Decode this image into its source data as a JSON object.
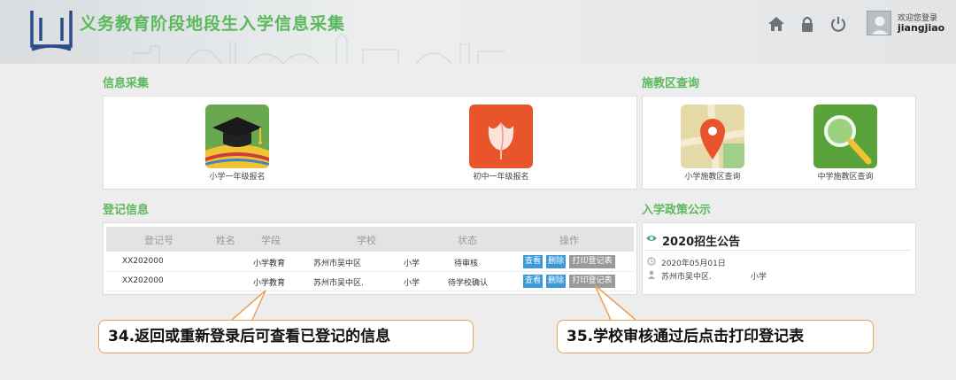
{
  "header": {
    "title": "义务教育阶段地段生入学信息采集",
    "welcome": "欢迎您登录",
    "username": "jiangjiao"
  },
  "info_collection": {
    "title": "信息采集",
    "items": [
      {
        "label": "小学一年级报名",
        "icon": "graduation-cap-icon"
      },
      {
        "label": "初中一年级报名",
        "icon": "tulip-icon"
      }
    ]
  },
  "district_query": {
    "title": "施教区查询",
    "items": [
      {
        "label": "小学施教区查询",
        "icon": "map-pin-icon"
      },
      {
        "label": "中学施教区查询",
        "icon": "magnifier-icon"
      }
    ]
  },
  "registration": {
    "title": "登记信息",
    "columns": [
      "登记号",
      "姓名",
      "学段",
      "学校",
      "状态",
      "操作"
    ],
    "rows": [
      {
        "id": "XX202000",
        "name": "",
        "stage": "小学教育",
        "school": "苏州市吴中区",
        "school_type": "小学",
        "status": "待审核",
        "actions": [
          "查看",
          "删除",
          "打印登记表"
        ]
      },
      {
        "id": "XX202000",
        "name": "",
        "stage": "小学教育",
        "school": "苏州市吴中区.",
        "school_type": "小学",
        "status": "待学校确认",
        "actions": [
          "查看",
          "删除",
          "打印登记表"
        ]
      }
    ]
  },
  "policy": {
    "title": "入学政策公示",
    "notice_title": "2020招生公告",
    "date": "2020年05月01日",
    "district": "苏州市吴中区.",
    "school_type": "小学"
  },
  "callouts": [
    "34.返回或重新登录后可查看已登记的信息",
    "35.学校审核通过后点击打印登记表"
  ],
  "colors": {
    "accent_green": "#5cb85c",
    "button_blue": "#3a9ad9",
    "button_gray": "#9a9a9a",
    "callout_border": "#e8a25a"
  }
}
